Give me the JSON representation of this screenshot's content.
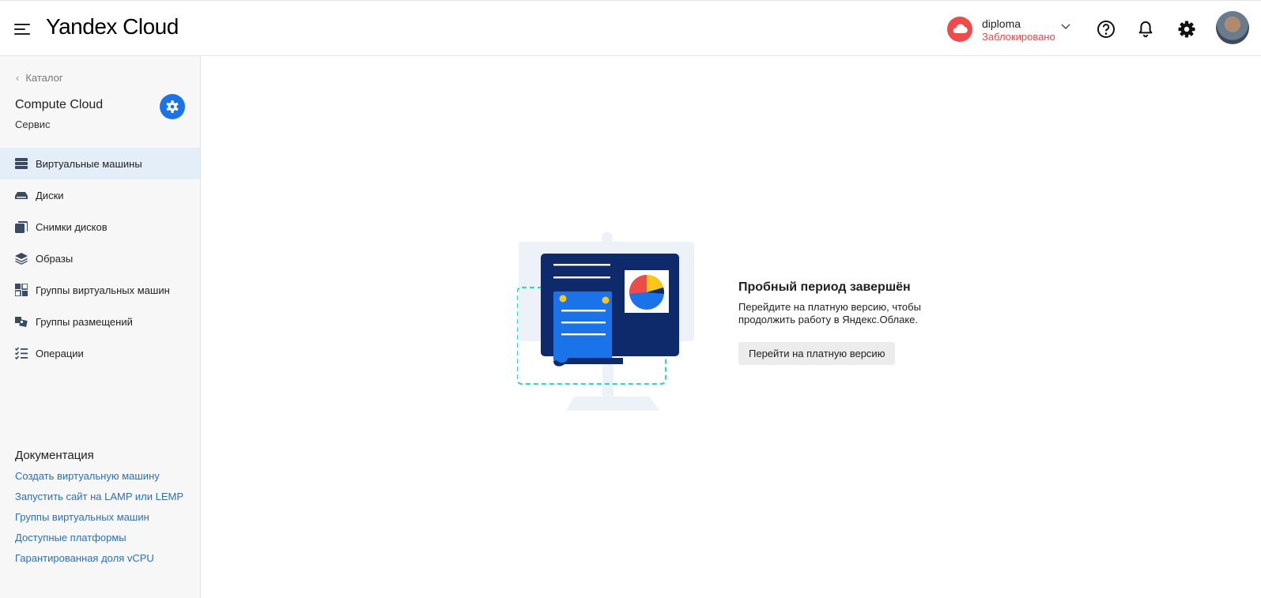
{
  "header": {
    "logo_text_1": "Yandex",
    "logo_text_2": "Cloud",
    "account_name": "diploma",
    "account_status": "Заблокировано",
    "icons": [
      "menu-icon",
      "cloud-icon",
      "chevron-down-icon",
      "help-icon",
      "bell-icon",
      "gear-icon"
    ],
    "status_color": "#e5484d",
    "badge_color": "#f04b4b"
  },
  "sidebar": {
    "back_label": "Каталог",
    "service_title": "Compute Cloud",
    "service_subtitle": "Сервис",
    "items": [
      {
        "label": "Виртуальные машины",
        "icon": "servers-icon",
        "active": true
      },
      {
        "label": "Диски",
        "icon": "disk-icon"
      },
      {
        "label": "Снимки дисков",
        "icon": "snapshot-icon"
      },
      {
        "label": "Образы",
        "icon": "layers-icon"
      },
      {
        "label": "Группы виртуальных машин",
        "icon": "group-icon"
      },
      {
        "label": "Группы размещений",
        "icon": "placement-icon"
      },
      {
        "label": "Операции",
        "icon": "checklist-icon"
      }
    ],
    "docs_title": "Документация",
    "docs_links": [
      "Создать виртуальную машину",
      "Запустить сайт на LAMP или LEMP",
      "Группы виртуальных машин",
      "Доступные платформы",
      "Гарантированная доля vCPU"
    ]
  },
  "main": {
    "empty_title": "Пробный период завершён",
    "empty_text": "Перейдите на платную версию, чтобы продолжить работу в Яндекс.Облаке.",
    "cta_label": "Перейти на платную версию"
  },
  "colors": {
    "accent": "#1a73e8",
    "active_bg": "#e4eef8",
    "link": "#2f6fb3"
  }
}
